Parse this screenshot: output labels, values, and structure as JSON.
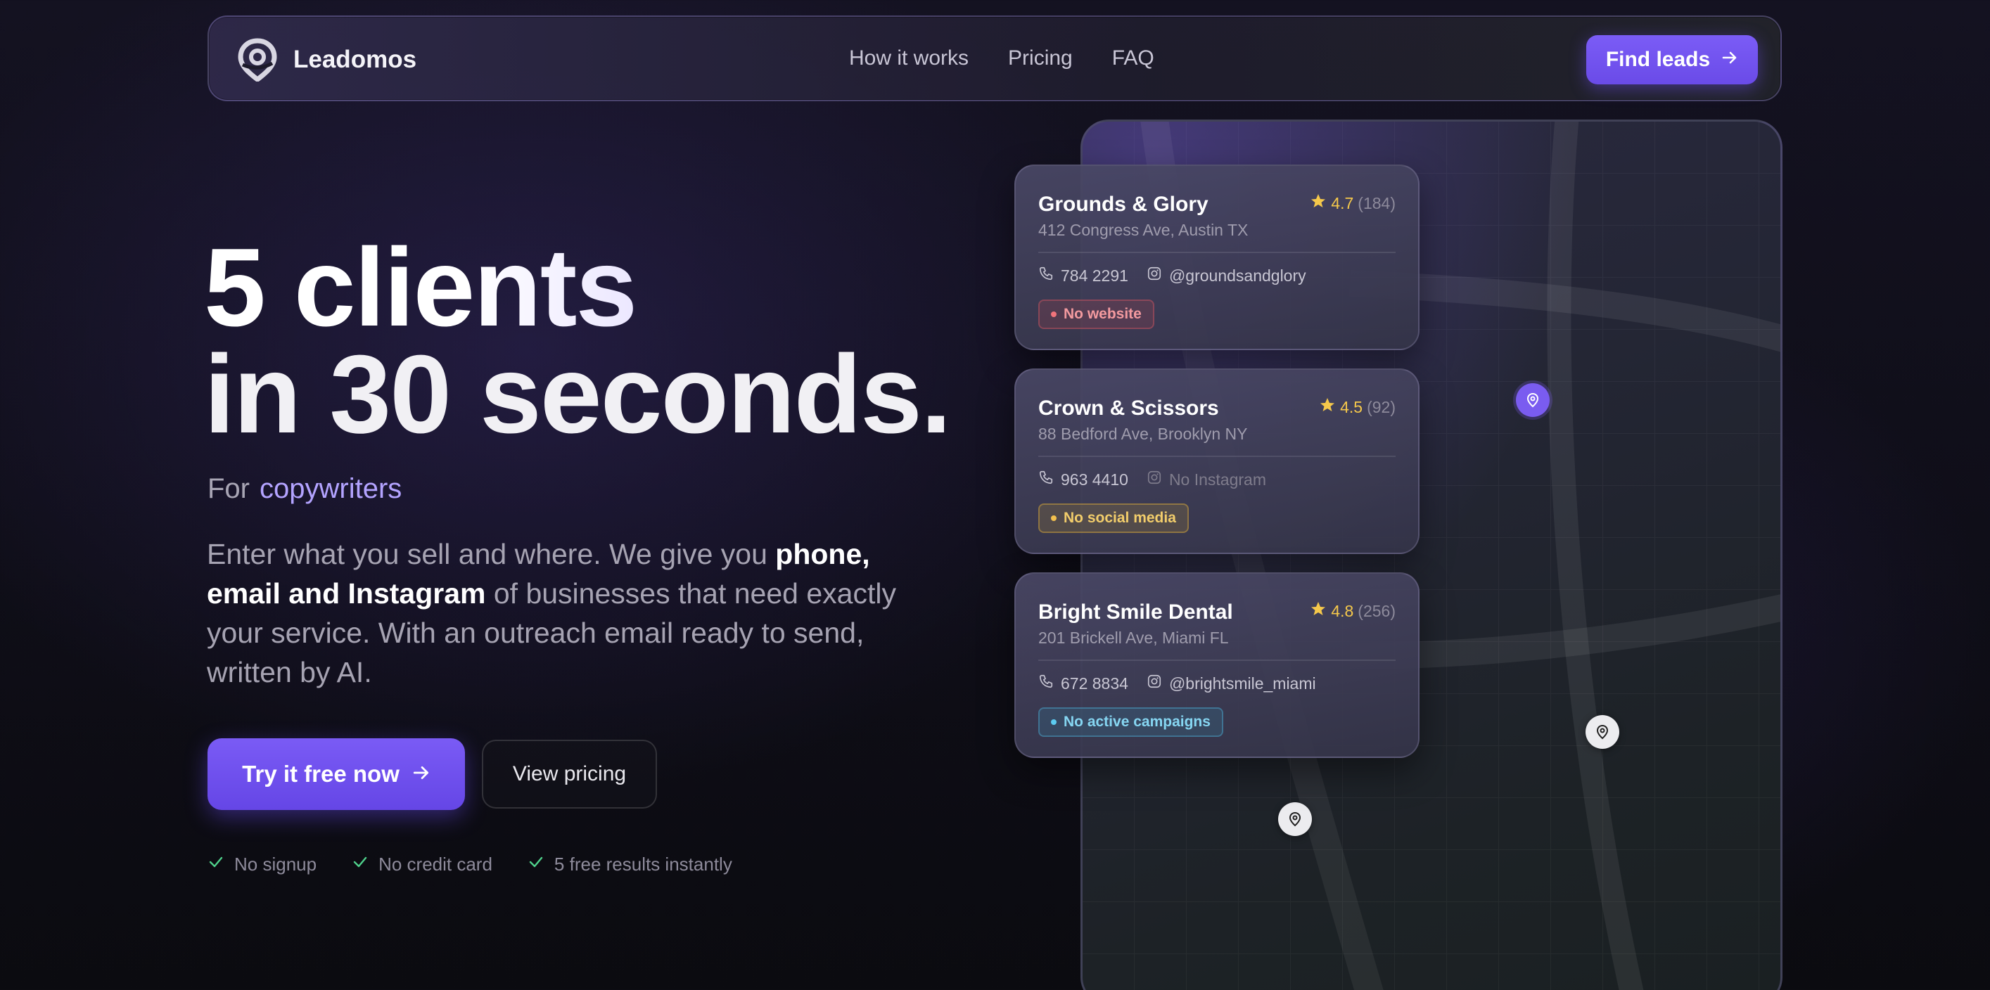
{
  "brand": {
    "name": "Leadomos",
    "logo_icon": "map-pin-logo-icon"
  },
  "nav": {
    "links": [
      "How it works",
      "Pricing",
      "FAQ"
    ],
    "cta_label": "Find leads"
  },
  "hero": {
    "title_line1": "5 clients",
    "title_line2": "in 30 seconds.",
    "for_label": "For",
    "for_value": "copywriters",
    "desc_part1": "Enter what you sell and where. We give you ",
    "desc_bold": "phone, email and Instagram",
    "desc_part2": " of businesses that need exactly your service. With an outreach email ready to send, written by AI.",
    "primary_cta": "Try it free now",
    "secondary_cta": "View pricing",
    "checks": [
      "No signup",
      "No credit card",
      "5 free results instantly"
    ]
  },
  "colors": {
    "accent": "#7a5bf5",
    "accent_text": "#b3a3ff",
    "star": "#f5c84b"
  },
  "cards": [
    {
      "name": "Grounds & Glory",
      "address": "412 Congress Ave, Austin TX",
      "rating": "4.7",
      "reviews": "(184)",
      "phone": "784 2291",
      "instagram": "@groundsandglory",
      "badge": "No website"
    },
    {
      "name": "Crown & Scissors",
      "address": "88 Bedford Ave, Brooklyn NY",
      "rating": "4.5",
      "reviews": "(92)",
      "phone": "963 4410",
      "instagram": "No Instagram",
      "badge": "No social media"
    },
    {
      "name": "Bright Smile Dental",
      "address": "201 Brickell Ave, Miami FL",
      "rating": "4.8",
      "reviews": "(256)",
      "phone": "672 8834",
      "instagram": "@brightsmile_miami",
      "badge": "No active campaigns"
    }
  ]
}
